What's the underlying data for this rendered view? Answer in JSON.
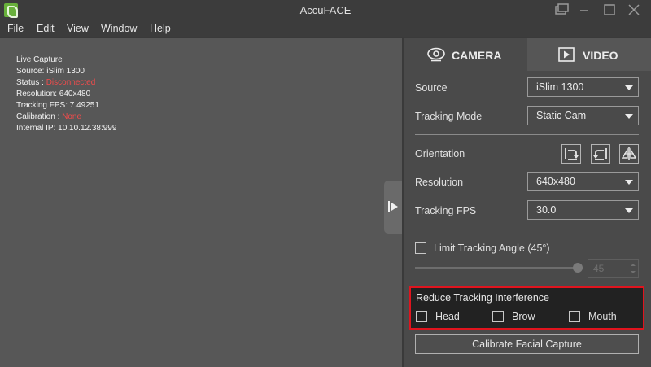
{
  "window": {
    "title": "AccuFACE"
  },
  "menu": {
    "file": "File",
    "edit": "Edit",
    "view": "View",
    "window": "Window",
    "help": "Help"
  },
  "info": {
    "live_capture": "Live Capture",
    "source": "Source: iSlim 1300",
    "status_label": "Status : ",
    "status_value": "Disconnected",
    "resolution": "Resolution: 640x480",
    "tracking_fps": "Tracking FPS: 7.49251",
    "calibration_label": "Calibration : ",
    "calibration_value": "None",
    "internal_ip": "Internal IP: 10.10.12.38:999"
  },
  "tabs": {
    "camera": "CAMERA",
    "video": "VIDEO"
  },
  "settings": {
    "source_label": "Source",
    "source_value": "iSlim 1300",
    "tracking_mode_label": "Tracking Mode",
    "tracking_mode_value": "Static Cam",
    "orientation_label": "Orientation",
    "resolution_label": "Resolution",
    "resolution_value": "640x480",
    "tracking_fps_label": "Tracking FPS",
    "tracking_fps_value": "30.0",
    "limit_angle_label": "Limit Tracking Angle (45°)",
    "angle_value": "45"
  },
  "interference": {
    "title": "Reduce Tracking Interference",
    "head": "Head",
    "brow": "Brow",
    "mouth": "Mouth"
  },
  "calibrate_label": "Calibrate Facial Capture",
  "colors": {
    "status_red": "#f24b4b",
    "highlight_border": "#e0141e",
    "app_icon_green": "#68b03b"
  },
  "icons": {
    "app": "accuface-icon",
    "camera_tab": "webcam-icon",
    "video_tab": "play-icon",
    "collapse": "collapse-panel-icon",
    "orientation": [
      "rotate-right-icon",
      "rotate-left-icon",
      "flip-icon"
    ]
  }
}
